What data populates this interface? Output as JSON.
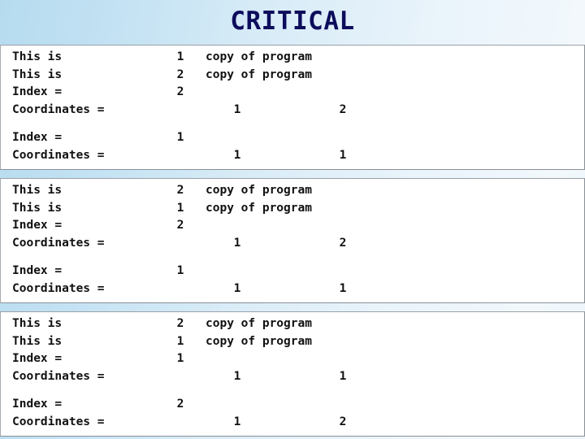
{
  "slide": {
    "title": "CRITICAL",
    "title_color": "#0d0d5c",
    "background_left_color": "#b6dbef",
    "background_right_color": "#eef6fb"
  },
  "console_blocks": [
    {
      "block_id": "block-1",
      "lines": [
        {
          "label": "This is",
          "num": "1",
          "text": "copy of program",
          "coord1": "",
          "coord2": ""
        },
        {
          "label": "This is",
          "num": "2",
          "text": "copy of program",
          "coord1": "",
          "coord2": ""
        },
        {
          "label": "Index =",
          "num": "2",
          "text": "",
          "coord1": "",
          "coord2": ""
        },
        {
          "label": "Coordinates =",
          "num": "",
          "text": "",
          "coord1": "1",
          "coord2": "2"
        },
        {
          "spacer": true
        },
        {
          "label": "Index =",
          "num": "1",
          "text": "",
          "coord1": "",
          "coord2": ""
        },
        {
          "label": "Coordinates =",
          "num": "",
          "text": "",
          "coord1": "1",
          "coord2": "1"
        }
      ]
    },
    {
      "block_id": "block-2",
      "lines": [
        {
          "label": "This is",
          "num": "2",
          "text": "copy of program",
          "coord1": "",
          "coord2": ""
        },
        {
          "label": "This is",
          "num": "1",
          "text": "copy of program",
          "coord1": "",
          "coord2": ""
        },
        {
          "label": "Index =",
          "num": "2",
          "text": "",
          "coord1": "",
          "coord2": ""
        },
        {
          "label": "Coordinates =",
          "num": "",
          "text": "",
          "coord1": "1",
          "coord2": "2"
        },
        {
          "spacer": true
        },
        {
          "label": "Index =",
          "num": "1",
          "text": "",
          "coord1": "",
          "coord2": ""
        },
        {
          "label": "Coordinates =",
          "num": "",
          "text": "",
          "coord1": "1",
          "coord2": "1"
        }
      ]
    },
    {
      "block_id": "block-3",
      "lines": [
        {
          "label": "This is",
          "num": "2",
          "text": "copy of program",
          "coord1": "",
          "coord2": ""
        },
        {
          "label": "This is",
          "num": "1",
          "text": "copy of program",
          "coord1": "",
          "coord2": ""
        },
        {
          "label": "Index =",
          "num": "1",
          "text": "",
          "coord1": "",
          "coord2": ""
        },
        {
          "label": "Coordinates =",
          "num": "",
          "text": "",
          "coord1": "1",
          "coord2": "1"
        },
        {
          "spacer": true
        },
        {
          "label": "Index =",
          "num": "2",
          "text": "",
          "coord1": "",
          "coord2": ""
        },
        {
          "label": "Coordinates =",
          "num": "",
          "text": "",
          "coord1": "1",
          "coord2": "2"
        }
      ]
    }
  ]
}
